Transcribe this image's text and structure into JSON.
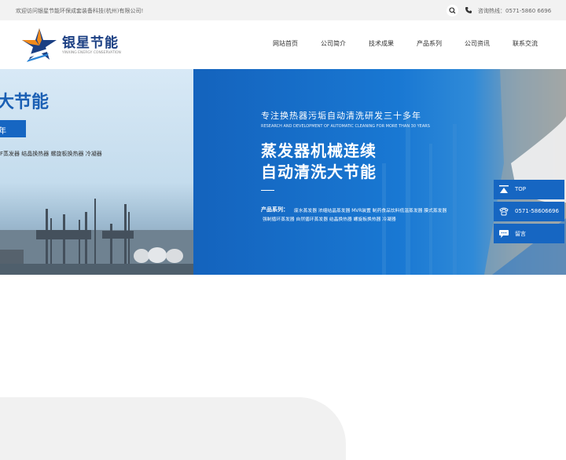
{
  "topbar": {
    "welcome": "欢迎访问银星节能环保成套装备科技(杭州)有限公司!",
    "hotline": "咨询热线：0571-5860 6696",
    "icons": [
      "search-icon",
      "phone-icon"
    ]
  },
  "logo": {
    "cn": "银星节能",
    "en": "YINXING ENERGY CONSERVATION",
    "colors": {
      "navy": "#1b3f83",
      "orange": "#f08a1c"
    }
  },
  "nav": [
    "网站首页",
    "公司简介",
    "技术成果",
    "产品系列",
    "公司资讯",
    "联系交流"
  ],
  "banner_left": {
    "title": "大节能",
    "pill": "年",
    "products": "F蒸发器   结晶换热器   螺旋板换热器   冷凝器"
  },
  "banner_right": {
    "slogan": "专注换热器污垢自动清洗研发三十多年",
    "slogan_en": "RESEARCH AND DEVELOPMENT OF AUTOMATIC CLEANING FOR MORE THAN 30 YEARS",
    "big1": "蒸发器机械连续",
    "big2": "自动清洗大节能",
    "products_label": "产品系列：",
    "products_row1": "废水蒸发器   浓缩结晶蒸发器   MVR装置   制药食品饮料低温蒸发器   膜式蒸发器",
    "products_row2": "强制循环蒸发器   自然循环蒸发器   结晶换热器   螺旋板换热器   冷凝器"
  },
  "float": {
    "top": "TOP",
    "phone": "0571-58606696",
    "message": "留言"
  },
  "colors": {
    "primary": "#1666c2",
    "topbar_bg": "#f2f2f2"
  }
}
